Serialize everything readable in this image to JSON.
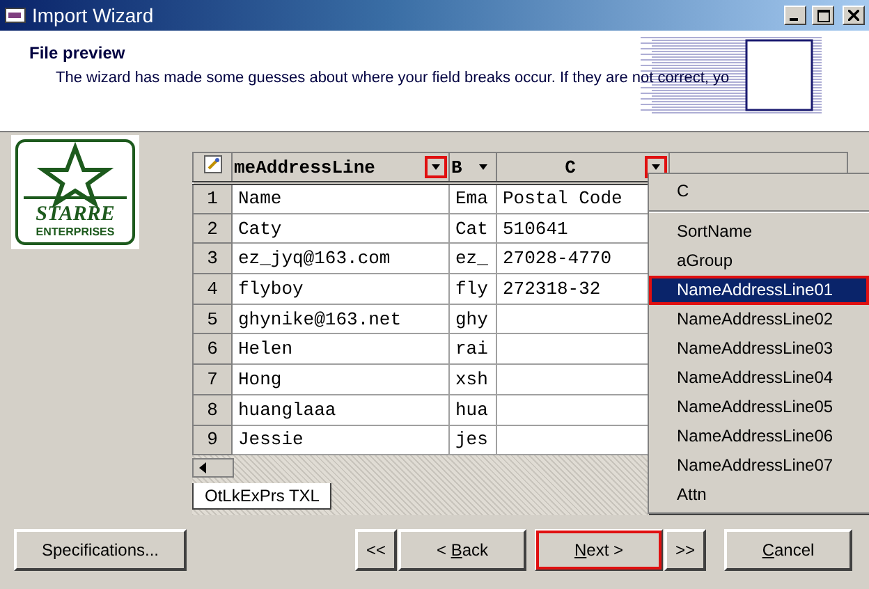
{
  "window": {
    "title": "Import Wizard"
  },
  "header": {
    "title": "File preview",
    "description": "The wizard has made some guesses about where your field breaks occur. If they are not correct, yo"
  },
  "logo": {
    "line1": "STARRE",
    "line2": "ENTERPRISES"
  },
  "grid": {
    "columns": [
      {
        "label": "meAddressLine",
        "highlighted": true
      },
      {
        "label": "B",
        "highlighted": false
      },
      {
        "label": "C",
        "highlighted": true
      }
    ],
    "rows": [
      {
        "number": "1",
        "cells": [
          "Name",
          "Ema",
          "Postal Code"
        ]
      },
      {
        "number": "2",
        "cells": [
          "Caty",
          "Cat",
          "510641"
        ]
      },
      {
        "number": "3",
        "cells": [
          "ez_jyq@163.com",
          "ez_",
          "27028-4770"
        ]
      },
      {
        "number": "4",
        "cells": [
          "flyboy",
          "fly",
          "272318-32"
        ]
      },
      {
        "number": "5",
        "cells": [
          "ghynike@163.net",
          "ghy"
        ]
      },
      {
        "number": "6",
        "cells": [
          "Helen",
          "rai"
        ]
      },
      {
        "number": "7",
        "cells": [
          "Hong",
          "xsh"
        ]
      },
      {
        "number": "8",
        "cells": [
          "huanglaaa",
          "hua"
        ]
      },
      {
        "number": "9",
        "cells": [
          "Jessie",
          "jes"
        ]
      }
    ],
    "sheet_tab": "OtLkExPrs TXL"
  },
  "dropdown": {
    "current": "C",
    "items": [
      {
        "label": "SortName",
        "selected": false
      },
      {
        "label": "aGroup",
        "selected": false
      },
      {
        "label": "NameAddressLine01",
        "selected": true
      },
      {
        "label": "NameAddressLine02",
        "selected": false
      },
      {
        "label": "NameAddressLine03",
        "selected": false
      },
      {
        "label": "NameAddressLine04",
        "selected": false
      },
      {
        "label": "NameAddressLine05",
        "selected": false
      },
      {
        "label": "NameAddressLine06",
        "selected": false
      },
      {
        "label": "NameAddressLine07",
        "selected": false
      },
      {
        "label": "Attn",
        "selected": false
      }
    ]
  },
  "buttons": [
    {
      "before": "Specifications...",
      "highlighted": false
    },
    {
      "before": "<<",
      "highlighted": false
    },
    {
      "before": "< ",
      "key": "B",
      "after": "ack",
      "highlighted": false
    },
    {
      "key": "N",
      "after": "ext >",
      "highlighted": true
    },
    {
      "before": ">>",
      "highlighted": false
    },
    {
      "key": "C",
      "after": "ancel",
      "highlighted": false
    }
  ]
}
